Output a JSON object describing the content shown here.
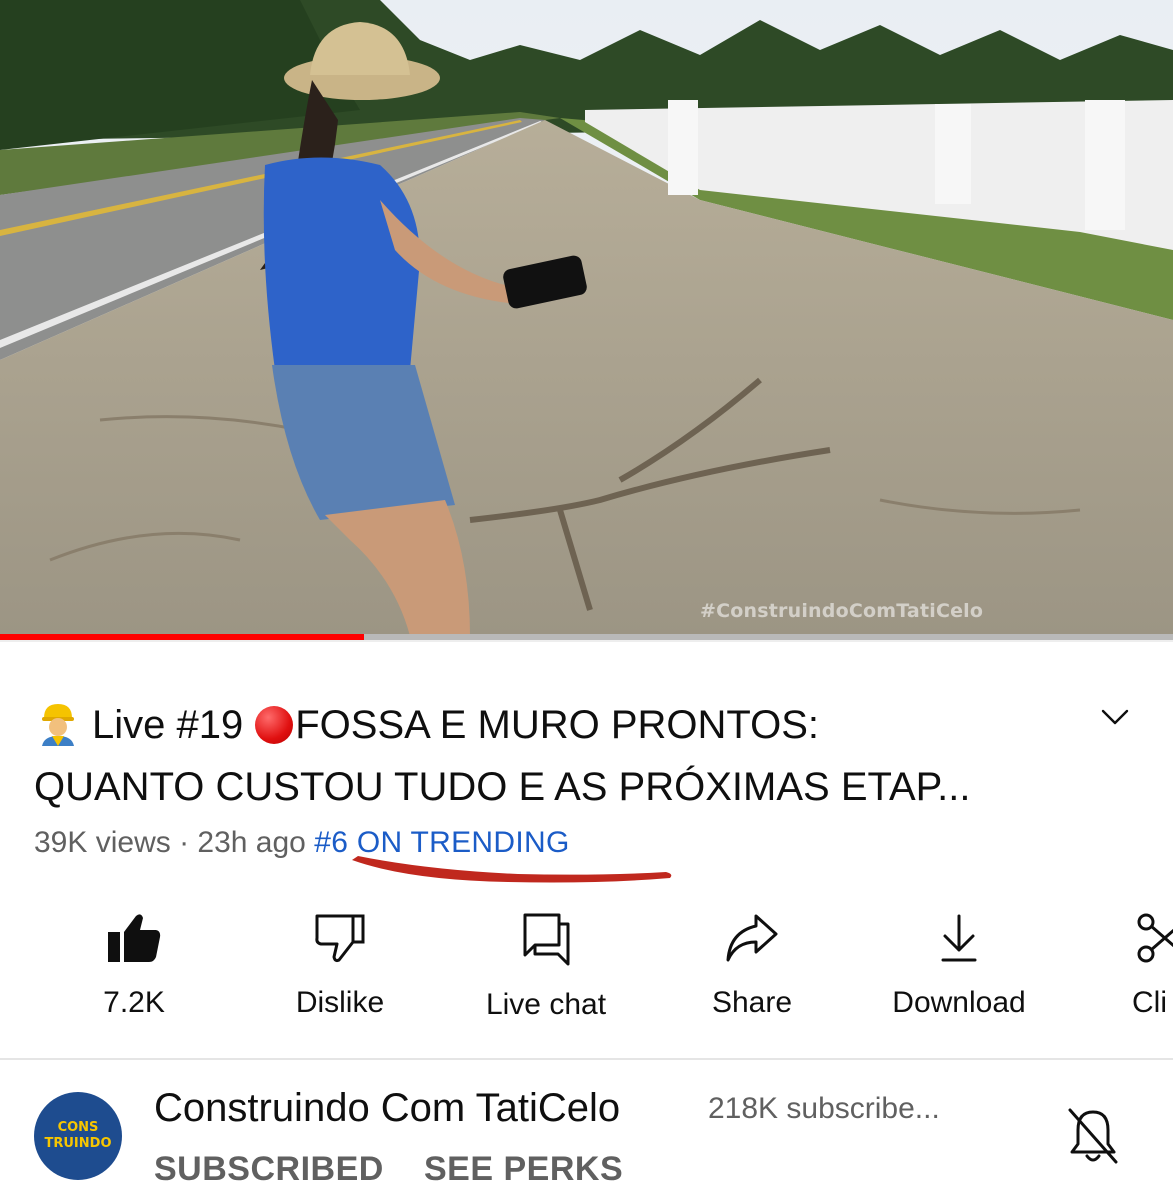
{
  "video": {
    "watermark": "#ConstruindoComTatiCelo",
    "progress_fraction": 0.31,
    "colors": {
      "progress": "#ff0000",
      "track": "#b9b9b9"
    }
  },
  "title": {
    "worker_icon": "construction-worker-emoji",
    "part1": "Live #19",
    "live_icon": "red-circle-emoji",
    "part2": "FOSSA E MURO PRONTOS:",
    "line2": "QUANTO CUSTOU TUDO E AS PRÓXIMAS ETAP..."
  },
  "meta": {
    "views": "39K views",
    "separator": "·",
    "age": "23h ago",
    "trending": "#6 ON TRENDING",
    "trending_color": "#1b5cc7",
    "annotation_color": "#c0281e"
  },
  "actions": [
    {
      "label": "7.2K",
      "icon": "thumbs-up-filled-icon"
    },
    {
      "label": "Dislike",
      "icon": "thumbs-down-icon"
    },
    {
      "label": "Live chat",
      "icon": "chat-icon"
    },
    {
      "label": "Share",
      "icon": "share-arrow-icon"
    },
    {
      "label": "Download",
      "icon": "download-icon"
    },
    {
      "label": "Cli",
      "icon": "scissors-icon"
    }
  ],
  "channel": {
    "avatar_text_1": "CONS",
    "avatar_text_2": "TRUINDO",
    "name": "Construindo Com TatiCelo",
    "subscribers": "218K subscribe...",
    "subscribed_label": "SUBSCRIBED",
    "perks_label": "SEE PERKS",
    "bell_icon": "bell-off-icon"
  }
}
